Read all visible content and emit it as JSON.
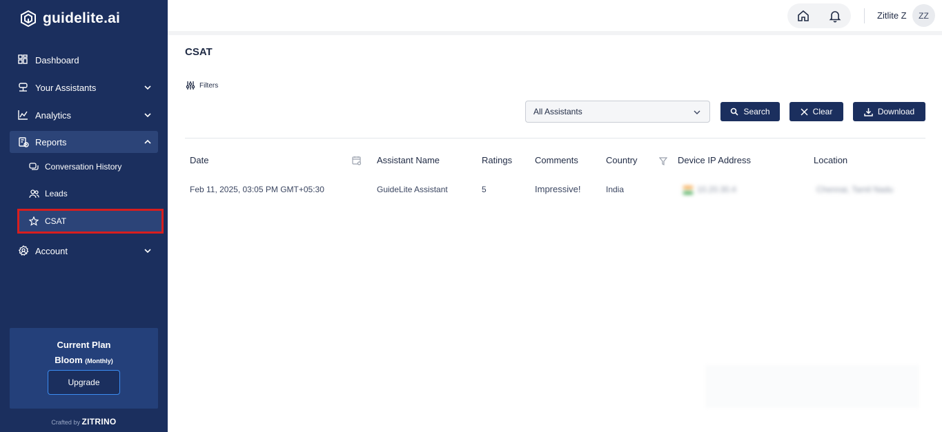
{
  "brand": {
    "name": "guidelite.ai"
  },
  "sidebar": {
    "items": [
      {
        "label": "Dashboard",
        "icon": "dashboard-icon"
      },
      {
        "label": "Your Assistants",
        "icon": "assistant-icon"
      },
      {
        "label": "Analytics",
        "icon": "analytics-icon"
      },
      {
        "label": "Reports",
        "icon": "reports-icon"
      },
      {
        "label": "Account",
        "icon": "account-icon"
      }
    ],
    "sub_items": [
      {
        "label": "Conversation History",
        "icon": "conversation-icon"
      },
      {
        "label": "Leads",
        "icon": "leads-icon"
      },
      {
        "label": "CSAT",
        "icon": "star-icon"
      }
    ],
    "plan": {
      "title": "Current Plan",
      "name": "Bloom",
      "cycle": "(Monthly)",
      "upgrade_label": "Upgrade"
    },
    "crafted_prefix": "Crafted by",
    "crafted_brand": "ZITRINO"
  },
  "topbar": {
    "username": "Zitlite Z",
    "avatar_initials": "ZZ"
  },
  "main": {
    "title": "CSAT",
    "filters_label": "Filters",
    "assistant_select": "All Assistants",
    "search_label": "Search",
    "clear_label": "Clear",
    "download_label": "Download"
  },
  "table": {
    "columns": [
      "Date",
      "Assistant Name",
      "Ratings",
      "Comments",
      "Country",
      "Device IP Address",
      "Location"
    ],
    "rows": [
      {
        "date": "Feb 11, 2025, 03:05 PM GMT+05:30",
        "assistant_name": "GuideLite Assistant",
        "ratings": "5",
        "comments": "Impressive!",
        "country": "India",
        "ip": "10.20.30.4",
        "location": "Chennai, Tamil Nadu"
      }
    ]
  },
  "colors": {
    "sidebar_bg": "#1b2f5e",
    "accent": "#1b2f5e",
    "highlight": "#d81e1e"
  }
}
